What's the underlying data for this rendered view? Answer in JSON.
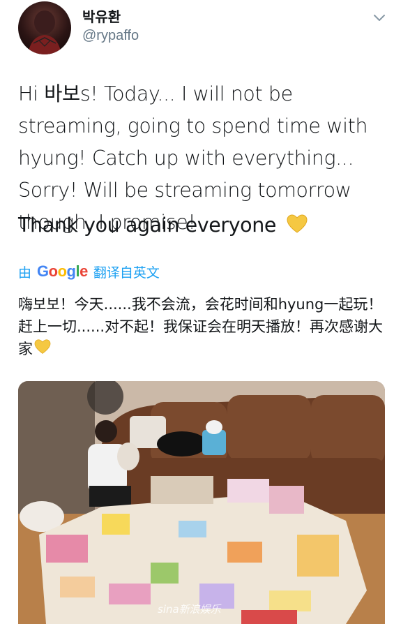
{
  "user": {
    "display_name": "박유환",
    "handle": "@rypaffo"
  },
  "tweet": {
    "text": "Hi 바보s! Today... I will not be streaming, going to spend time with hyung! Catch up with everything... Sorry! Will be streaming tomorrow though, I promise!",
    "thanks": "Thank you again everyone"
  },
  "translate_bar": {
    "prefix": "由",
    "logo": "Google",
    "suffix": "翻译自英文"
  },
  "translation": {
    "text": "嗨보보！今天......我不会流，会花时间和hyung一起玩！赶上一切......对不起！我保证会在明天播放！再次感谢大家"
  },
  "photo": {
    "watermark": "sina新浪娱乐"
  },
  "colors": {
    "link": "#1da1f2",
    "handle": "#657786",
    "heart": "#f5c842"
  },
  "icons": {
    "chevron": "chevron-down-icon",
    "heart": "yellow-heart-icon"
  }
}
